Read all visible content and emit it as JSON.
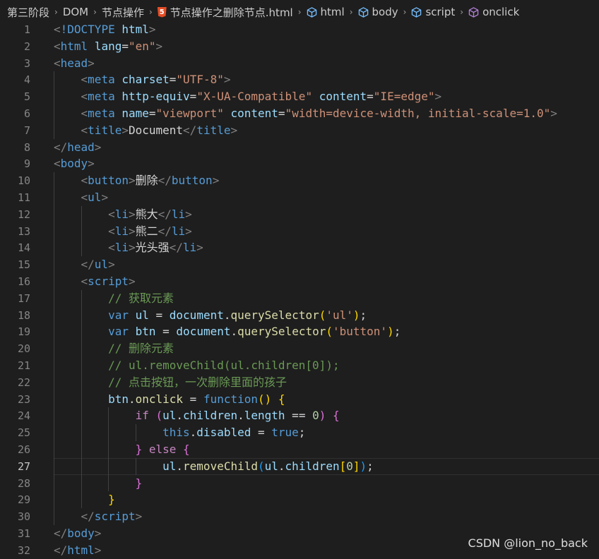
{
  "breadcrumb": [
    {
      "label": "第三阶段",
      "icon": ""
    },
    {
      "label": "DOM",
      "icon": ""
    },
    {
      "label": "节点操作",
      "icon": ""
    },
    {
      "label": "节点操作之删除节点.html",
      "icon": "html5-icon"
    },
    {
      "label": "html",
      "icon": "cube-icon"
    },
    {
      "label": "body",
      "icon": "cube-icon"
    },
    {
      "label": "script",
      "icon": "cube-icon"
    },
    {
      "label": "onclick",
      "icon": "cube-icon-purple"
    }
  ],
  "breadcrumb_separator": "›",
  "editor": {
    "current_line": 27,
    "lines": [
      {
        "n": "1",
        "tokens": [
          [
            "punct",
            "<"
          ],
          [
            "tag",
            "!DOCTYPE"
          ],
          [
            "text",
            " "
          ],
          [
            "attr",
            "html"
          ],
          [
            "punct",
            ">"
          ]
        ]
      },
      {
        "n": "2",
        "tokens": [
          [
            "punct",
            "<"
          ],
          [
            "tag",
            "html"
          ],
          [
            "text",
            " "
          ],
          [
            "attr",
            "lang"
          ],
          [
            "text",
            "="
          ],
          [
            "str",
            "\"en\""
          ],
          [
            "punct",
            ">"
          ]
        ]
      },
      {
        "n": "3",
        "tokens": [
          [
            "punct",
            "<"
          ],
          [
            "tag",
            "head"
          ],
          [
            "punct",
            ">"
          ]
        ]
      },
      {
        "n": "4",
        "tokens": [
          [
            "text",
            "    "
          ],
          [
            "punct",
            "<"
          ],
          [
            "tag",
            "meta"
          ],
          [
            "text",
            " "
          ],
          [
            "attr",
            "charset"
          ],
          [
            "text",
            "="
          ],
          [
            "str",
            "\"UTF-8\""
          ],
          [
            "punct",
            ">"
          ]
        ]
      },
      {
        "n": "5",
        "tokens": [
          [
            "text",
            "    "
          ],
          [
            "punct",
            "<"
          ],
          [
            "tag",
            "meta"
          ],
          [
            "text",
            " "
          ],
          [
            "attr",
            "http-equiv"
          ],
          [
            "text",
            "="
          ],
          [
            "str",
            "\"X-UA-Compatible\""
          ],
          [
            "text",
            " "
          ],
          [
            "attr",
            "content"
          ],
          [
            "text",
            "="
          ],
          [
            "str",
            "\"IE=edge\""
          ],
          [
            "punct",
            ">"
          ]
        ]
      },
      {
        "n": "6",
        "tokens": [
          [
            "text",
            "    "
          ],
          [
            "punct",
            "<"
          ],
          [
            "tag",
            "meta"
          ],
          [
            "text",
            " "
          ],
          [
            "attr",
            "name"
          ],
          [
            "text",
            "="
          ],
          [
            "str",
            "\"viewport\""
          ],
          [
            "text",
            " "
          ],
          [
            "attr",
            "content"
          ],
          [
            "text",
            "="
          ],
          [
            "str",
            "\"width=device-width, initial-scale=1.0\""
          ],
          [
            "punct",
            ">"
          ]
        ]
      },
      {
        "n": "7",
        "tokens": [
          [
            "text",
            "    "
          ],
          [
            "punct",
            "<"
          ],
          [
            "tag",
            "title"
          ],
          [
            "punct",
            ">"
          ],
          [
            "text",
            "Document"
          ],
          [
            "punct",
            "</"
          ],
          [
            "tag",
            "title"
          ],
          [
            "punct",
            ">"
          ]
        ]
      },
      {
        "n": "8",
        "tokens": [
          [
            "punct",
            "</"
          ],
          [
            "tag",
            "head"
          ],
          [
            "punct",
            ">"
          ]
        ]
      },
      {
        "n": "9",
        "tokens": [
          [
            "punct",
            "<"
          ],
          [
            "tag",
            "body"
          ],
          [
            "punct",
            ">"
          ]
        ]
      },
      {
        "n": "10",
        "tokens": [
          [
            "text",
            "    "
          ],
          [
            "punct",
            "<"
          ],
          [
            "tag",
            "button"
          ],
          [
            "punct",
            ">"
          ],
          [
            "text",
            "删除"
          ],
          [
            "punct",
            "</"
          ],
          [
            "tag",
            "button"
          ],
          [
            "punct",
            ">"
          ]
        ]
      },
      {
        "n": "11",
        "tokens": [
          [
            "text",
            "    "
          ],
          [
            "punct",
            "<"
          ],
          [
            "tag",
            "ul"
          ],
          [
            "punct",
            ">"
          ]
        ]
      },
      {
        "n": "12",
        "tokens": [
          [
            "text",
            "        "
          ],
          [
            "punct",
            "<"
          ],
          [
            "tag",
            "li"
          ],
          [
            "punct",
            ">"
          ],
          [
            "text",
            "熊大"
          ],
          [
            "punct",
            "</"
          ],
          [
            "tag",
            "li"
          ],
          [
            "punct",
            ">"
          ]
        ]
      },
      {
        "n": "13",
        "tokens": [
          [
            "text",
            "        "
          ],
          [
            "punct",
            "<"
          ],
          [
            "tag",
            "li"
          ],
          [
            "punct",
            ">"
          ],
          [
            "text",
            "熊二"
          ],
          [
            "punct",
            "</"
          ],
          [
            "tag",
            "li"
          ],
          [
            "punct",
            ">"
          ]
        ]
      },
      {
        "n": "14",
        "tokens": [
          [
            "text",
            "        "
          ],
          [
            "punct",
            "<"
          ],
          [
            "tag",
            "li"
          ],
          [
            "punct",
            ">"
          ],
          [
            "text",
            "光头强"
          ],
          [
            "punct",
            "</"
          ],
          [
            "tag",
            "li"
          ],
          [
            "punct",
            ">"
          ]
        ]
      },
      {
        "n": "15",
        "tokens": [
          [
            "text",
            "    "
          ],
          [
            "punct",
            "</"
          ],
          [
            "tag",
            "ul"
          ],
          [
            "punct",
            ">"
          ]
        ]
      },
      {
        "n": "16",
        "tokens": [
          [
            "text",
            "    "
          ],
          [
            "punct",
            "<"
          ],
          [
            "tag",
            "script"
          ],
          [
            "punct",
            ">"
          ]
        ]
      },
      {
        "n": "17",
        "tokens": [
          [
            "text",
            "        "
          ],
          [
            "cmt",
            "// 获取元素"
          ]
        ]
      },
      {
        "n": "18",
        "tokens": [
          [
            "text",
            "        "
          ],
          [
            "kw",
            "var"
          ],
          [
            "text",
            " "
          ],
          [
            "var",
            "ul"
          ],
          [
            "op",
            " = "
          ],
          [
            "var",
            "document"
          ],
          [
            "op",
            "."
          ],
          [
            "fn",
            "querySelector"
          ],
          [
            "b1",
            "("
          ],
          [
            "str",
            "'ul'"
          ],
          [
            "b1",
            ")"
          ],
          [
            "op",
            ";"
          ]
        ]
      },
      {
        "n": "19",
        "tokens": [
          [
            "text",
            "        "
          ],
          [
            "kw",
            "var"
          ],
          [
            "text",
            " "
          ],
          [
            "var",
            "btn"
          ],
          [
            "op",
            " = "
          ],
          [
            "var",
            "document"
          ],
          [
            "op",
            "."
          ],
          [
            "fn",
            "querySelector"
          ],
          [
            "b1",
            "("
          ],
          [
            "str",
            "'button'"
          ],
          [
            "b1",
            ")"
          ],
          [
            "op",
            ";"
          ]
        ]
      },
      {
        "n": "20",
        "tokens": [
          [
            "text",
            "        "
          ],
          [
            "cmt",
            "// 删除元素"
          ]
        ]
      },
      {
        "n": "21",
        "tokens": [
          [
            "text",
            "        "
          ],
          [
            "cmt",
            "// ul.removeChild(ul.children[0]);"
          ]
        ]
      },
      {
        "n": "22",
        "tokens": [
          [
            "text",
            "        "
          ],
          [
            "cmt",
            "// 点击按钮，一次删除里面的孩子"
          ]
        ]
      },
      {
        "n": "23",
        "tokens": [
          [
            "text",
            "        "
          ],
          [
            "var",
            "btn"
          ],
          [
            "op",
            "."
          ],
          [
            "fn",
            "onclick"
          ],
          [
            "op",
            " = "
          ],
          [
            "kw",
            "function"
          ],
          [
            "b1",
            "()"
          ],
          [
            "op",
            " "
          ],
          [
            "b1",
            "{"
          ]
        ]
      },
      {
        "n": "24",
        "tokens": [
          [
            "text",
            "            "
          ],
          [
            "ctrl",
            "if"
          ],
          [
            "op",
            " "
          ],
          [
            "b2",
            "("
          ],
          [
            "var",
            "ul"
          ],
          [
            "op",
            "."
          ],
          [
            "var",
            "children"
          ],
          [
            "op",
            "."
          ],
          [
            "var",
            "length"
          ],
          [
            "op",
            " == "
          ],
          [
            "num",
            "0"
          ],
          [
            "b2",
            ")"
          ],
          [
            "op",
            " "
          ],
          [
            "b2",
            "{"
          ]
        ]
      },
      {
        "n": "25",
        "tokens": [
          [
            "text",
            "                "
          ],
          [
            "kw",
            "this"
          ],
          [
            "op",
            "."
          ],
          [
            "var",
            "disabled"
          ],
          [
            "op",
            " = "
          ],
          [
            "kw",
            "true"
          ],
          [
            "op",
            ";"
          ]
        ]
      },
      {
        "n": "26",
        "tokens": [
          [
            "text",
            "            "
          ],
          [
            "b2",
            "}"
          ],
          [
            "op",
            " "
          ],
          [
            "ctrl",
            "else"
          ],
          [
            "op",
            " "
          ],
          [
            "b2",
            "{"
          ]
        ]
      },
      {
        "n": "27",
        "tokens": [
          [
            "text",
            "                "
          ],
          [
            "var",
            "ul"
          ],
          [
            "op",
            "."
          ],
          [
            "fn",
            "removeChild"
          ],
          [
            "b3",
            "("
          ],
          [
            "var",
            "ul"
          ],
          [
            "op",
            "."
          ],
          [
            "var",
            "children"
          ],
          [
            "b1",
            "["
          ],
          [
            "num",
            "0"
          ],
          [
            "b1",
            "]"
          ],
          [
            "b3",
            ")"
          ],
          [
            "op",
            ";"
          ]
        ]
      },
      {
        "n": "28",
        "tokens": [
          [
            "text",
            "            "
          ],
          [
            "b2",
            "}"
          ]
        ]
      },
      {
        "n": "29",
        "tokens": [
          [
            "text",
            "        "
          ],
          [
            "b1",
            "}"
          ]
        ]
      },
      {
        "n": "30",
        "tokens": [
          [
            "text",
            "    "
          ],
          [
            "punct",
            "</"
          ],
          [
            "tag",
            "script"
          ],
          [
            "punct",
            ">"
          ]
        ]
      },
      {
        "n": "31",
        "tokens": [
          [
            "punct",
            "</"
          ],
          [
            "tag",
            "body"
          ],
          [
            "punct",
            ">"
          ]
        ]
      },
      {
        "n": "32",
        "tokens": [
          [
            "punct",
            "</"
          ],
          [
            "tag",
            "html"
          ],
          [
            "punct",
            ">"
          ]
        ]
      }
    ]
  },
  "watermark": "CSDN @lion_no_back"
}
